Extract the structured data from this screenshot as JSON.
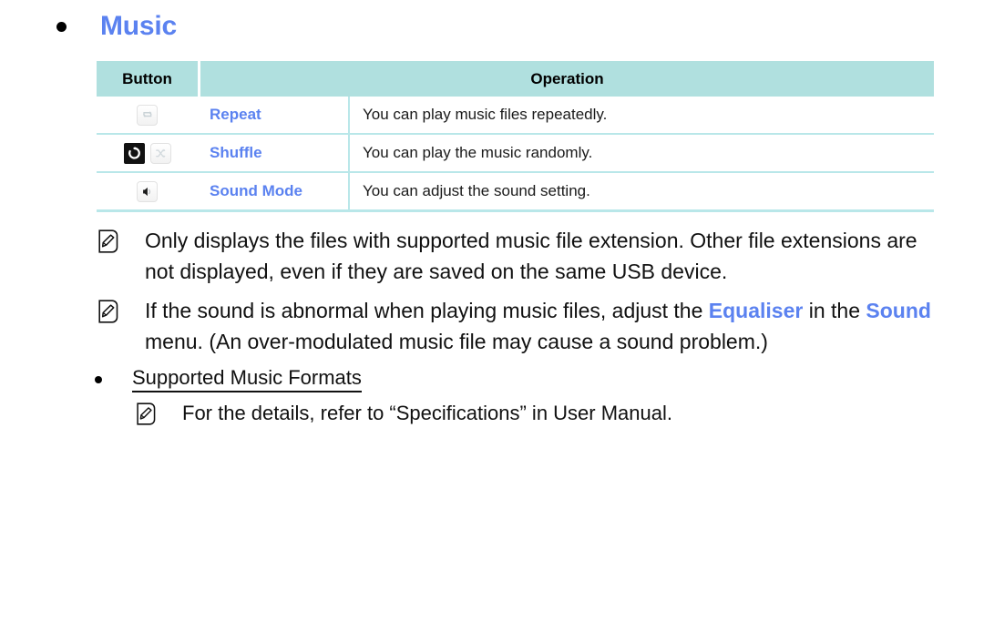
{
  "heading": {
    "bullet_icon": "filled-circle-bullet",
    "title": "Music",
    "title_color": "#5b82f0"
  },
  "table": {
    "headers": {
      "button": "Button",
      "operation": "Operation"
    },
    "header_bg": "#b0e0df",
    "border_color": "#b9e7e9",
    "label_color": "#5b82f0",
    "rows": [
      {
        "icons": [
          "repeat-icon"
        ],
        "label": "Repeat",
        "operation": "You can play music files repeatedly."
      },
      {
        "icons": [
          "rotate-icon",
          "shuffle-icon"
        ],
        "label": "Shuffle",
        "operation": "You can play the music randomly."
      },
      {
        "icons": [
          "speaker-icon"
        ],
        "label": "Sound Mode",
        "operation": "You can adjust the sound setting."
      }
    ]
  },
  "notes": [
    {
      "icon": "note-pencil-icon",
      "text": "Only displays the files with supported music file extension. Other file extensions are not displayed, even if they are saved on the same USB device."
    },
    {
      "icon": "note-pencil-icon",
      "segments": [
        {
          "text": "If the sound is abnormal when playing music files, adjust the ",
          "style": "plain"
        },
        {
          "text": "Equaliser",
          "style": "keyword"
        },
        {
          "text": " in the ",
          "style": "plain"
        },
        {
          "text": "Sound",
          "style": "keyword"
        },
        {
          "text": " menu. (An over-modulated music file may cause a sound problem.)",
          "style": "plain"
        }
      ]
    }
  ],
  "sub_bullet": {
    "bullet_icon": "filled-circle-bullet",
    "text": "Supported Music Formats"
  },
  "sub_note": {
    "icon": "note-pencil-icon",
    "text": "For the details, refer to “Specifications” in User Manual."
  },
  "colors": {
    "accent_blue": "#5b82f0",
    "table_header": "#b0e0df",
    "table_border": "#b9e7e9",
    "text": "#111111"
  }
}
